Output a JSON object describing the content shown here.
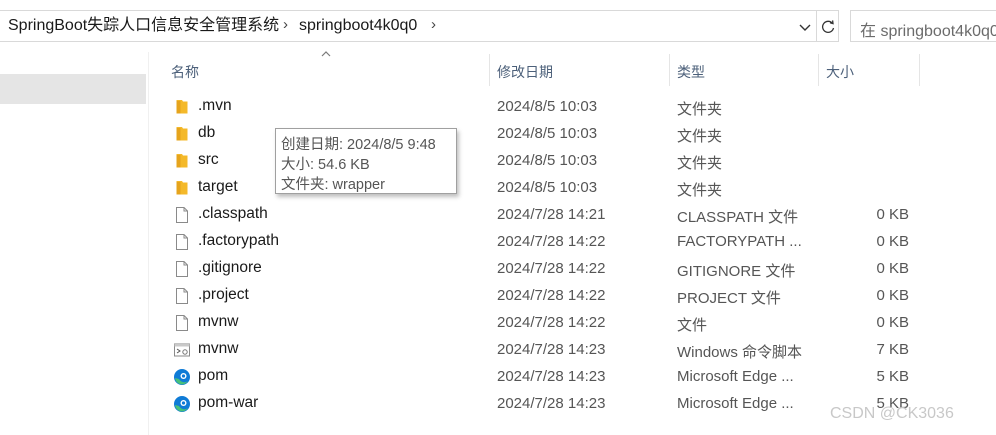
{
  "address_bar": {
    "breadcrumbs": [
      "SpringBoot失踪人口信息安全管理系统",
      "springboot4k0q0"
    ],
    "search_placeholder": "在 springboot4k0q0"
  },
  "columns": {
    "name": "名称",
    "date": "修改日期",
    "type": "类型",
    "size": "大小"
  },
  "files": [
    {
      "icon": "folder-icon",
      "name": ".mvn",
      "date": "2024/8/5 10:03",
      "type": "文件夹",
      "size": ""
    },
    {
      "icon": "folder-icon",
      "name": "db",
      "date": "2024/8/5 10:03",
      "type": "文件夹",
      "size": ""
    },
    {
      "icon": "folder-icon",
      "name": "src",
      "date": "2024/8/5 10:03",
      "type": "文件夹",
      "size": ""
    },
    {
      "icon": "folder-icon",
      "name": "target",
      "date": "2024/8/5 10:03",
      "type": "文件夹",
      "size": ""
    },
    {
      "icon": "file-icon",
      "name": ".classpath",
      "date": "2024/7/28 14:21",
      "type": "CLASSPATH 文件",
      "size": "0 KB"
    },
    {
      "icon": "file-icon",
      "name": ".factorypath",
      "date": "2024/7/28 14:22",
      "type": "FACTORYPATH ...",
      "size": "0 KB"
    },
    {
      "icon": "file-icon",
      "name": ".gitignore",
      "date": "2024/7/28 14:22",
      "type": "GITIGNORE 文件",
      "size": "0 KB"
    },
    {
      "icon": "file-icon",
      "name": ".project",
      "date": "2024/7/28 14:22",
      "type": "PROJECT 文件",
      "size": "0 KB"
    },
    {
      "icon": "file-icon",
      "name": "mvnw",
      "date": "2024/7/28 14:22",
      "type": "文件",
      "size": "0 KB"
    },
    {
      "icon": "cmd-file-icon",
      "name": "mvnw",
      "date": "2024/7/28 14:23",
      "type": "Windows 命令脚本",
      "size": "7 KB"
    },
    {
      "icon": "edge-icon",
      "name": "pom",
      "date": "2024/7/28 14:23",
      "type": "Microsoft Edge ...",
      "size": "5 KB"
    },
    {
      "icon": "edge-icon",
      "name": "pom-war",
      "date": "2024/7/28 14:23",
      "type": "Microsoft Edge ...",
      "size": "5 KB"
    }
  ],
  "tooltip": {
    "created": "创建日期: 2024/8/5 9:48",
    "size": "大小: 54.6 KB",
    "folder": "文件夹: wrapper"
  },
  "watermark": "CSDN @CK3036",
  "colors": {
    "folder": "#f4b92a",
    "header_text": "#4c607a",
    "selection": "#e5e5e5",
    "edge_blue": "#0f7bd6",
    "edge_green": "#47c07a"
  }
}
